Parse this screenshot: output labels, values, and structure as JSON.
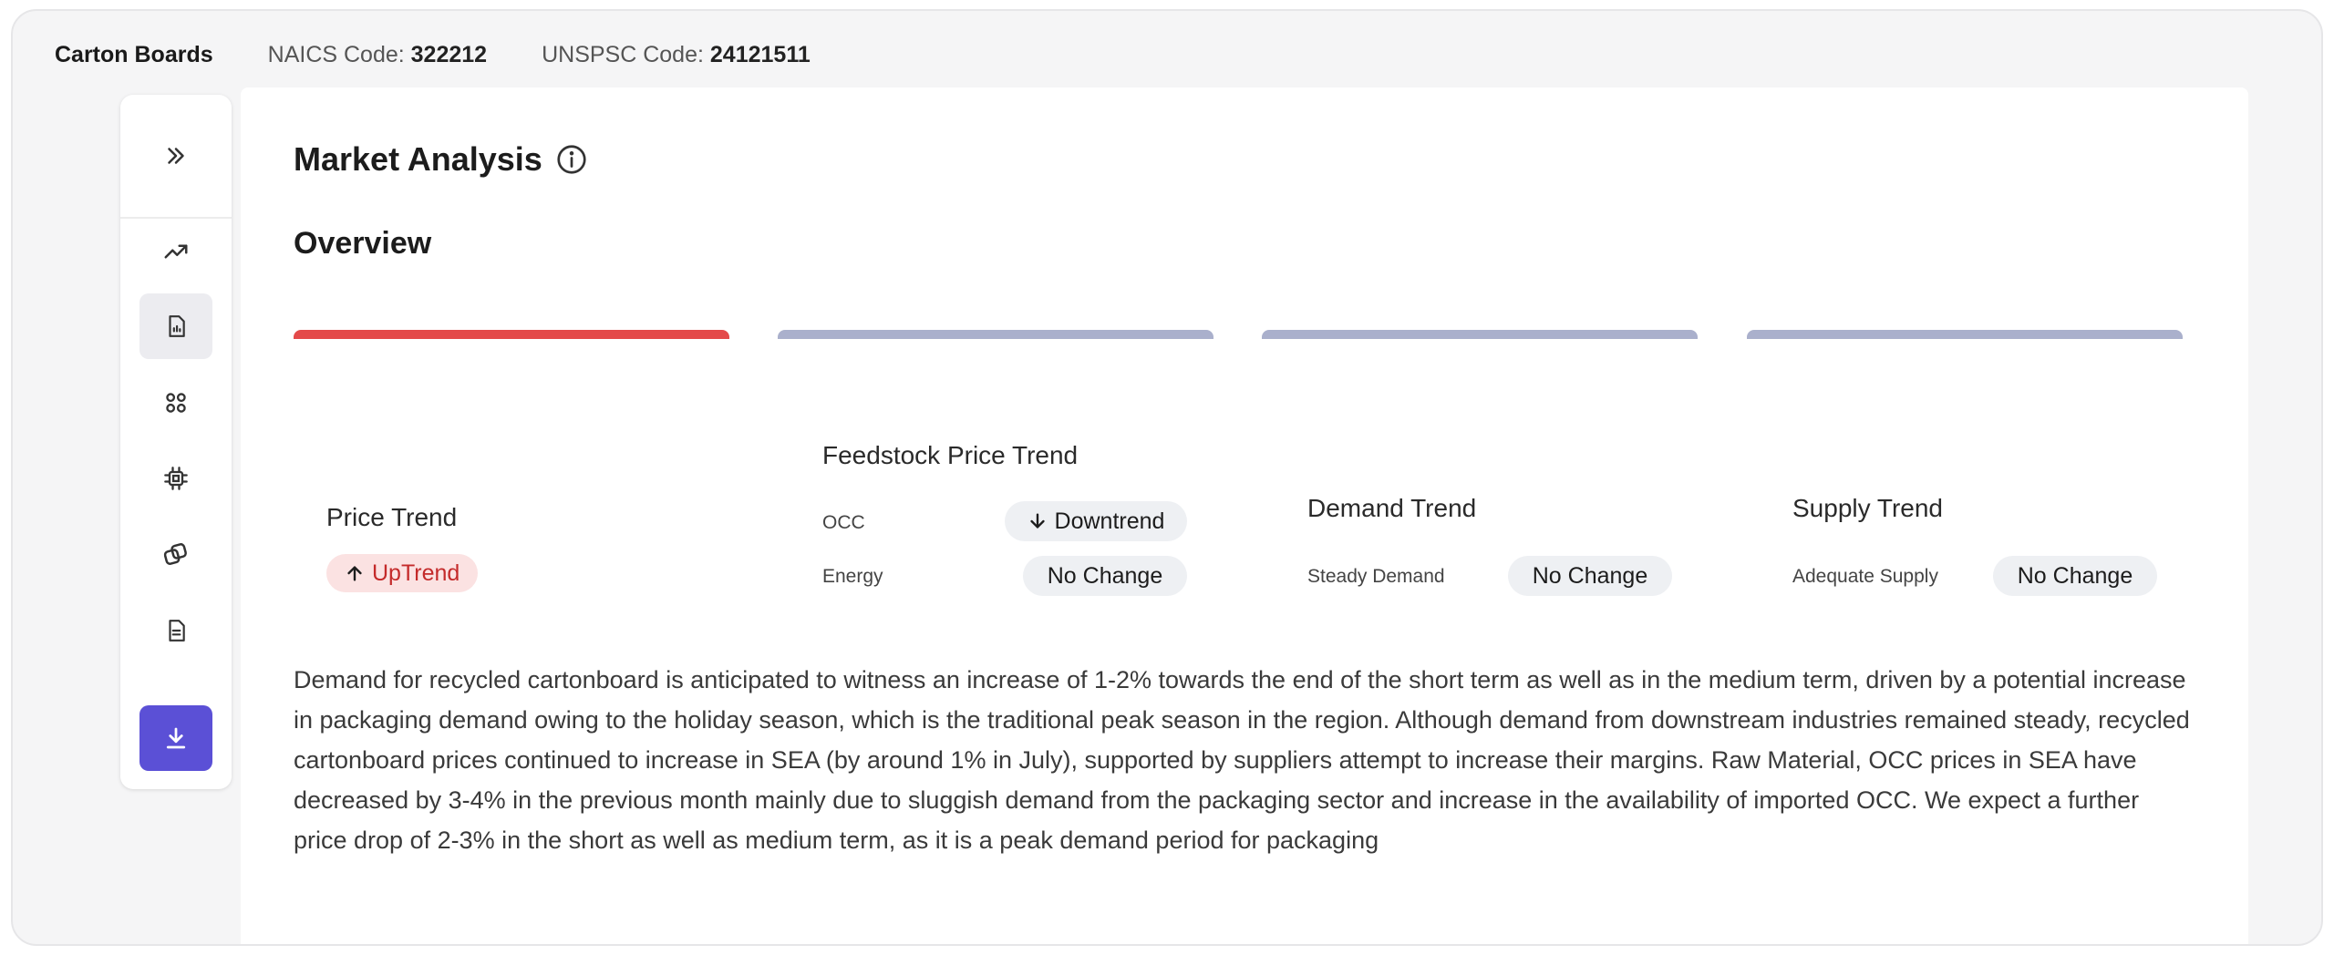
{
  "header": {
    "product": "Carton Boards",
    "naics_label": "NAICS Code:",
    "naics_value": "322212",
    "unspsc_label": "UNSPSC Code:",
    "unspsc_value": "24121511"
  },
  "sidebar": {
    "items": [
      {
        "icon": "expand-icon"
      },
      {
        "icon": "trend-icon"
      },
      {
        "icon": "report-icon",
        "active": true
      },
      {
        "icon": "grid-icon"
      },
      {
        "icon": "chip-icon"
      },
      {
        "icon": "layers-icon"
      },
      {
        "icon": "document-icon"
      },
      {
        "icon": "download-icon"
      }
    ]
  },
  "main": {
    "title": "Market Analysis",
    "section": "Overview",
    "cards": {
      "price": {
        "title": "Price Trend",
        "status": "UpTrend"
      },
      "feedstock": {
        "title": "Feedstock Price Trend",
        "rows": [
          {
            "label": "OCC",
            "status": "Downtrend"
          },
          {
            "label": "Energy",
            "status": "No Change"
          }
        ]
      },
      "demand": {
        "title": "Demand Trend",
        "label": "Steady Demand",
        "status": "No Change"
      },
      "supply": {
        "title": "Supply Trend",
        "label": "Adequate Supply",
        "status": "No Change"
      }
    },
    "description": "Demand for recycled cartonboard is anticipated to witness an increase of 1-2% towards the end of the short term as well as in the medium term, driven by a potential increase in packaging demand owing to the holiday season, which is the traditional peak season in the region. Although demand from downstream industries remained steady, recycled cartonboard prices continued to increase in SEA (by around 1% in July), supported by suppliers attempt to increase their margins. Raw Material, OCC prices in SEA have decreased by 3-4% in the previous month mainly due to sluggish demand from the packaging sector and increase in the availability of imported OCC. We expect a further price drop of 2-3% in the short as well as medium term, as it is a peak demand period for packaging"
  },
  "colors": {
    "accent": "#5b50d6",
    "active_bar": "#e44a4a",
    "inactive_bar": "#aab0cc",
    "uptrend_bg": "#fbe2e2",
    "uptrend_text": "#c42a2a"
  }
}
